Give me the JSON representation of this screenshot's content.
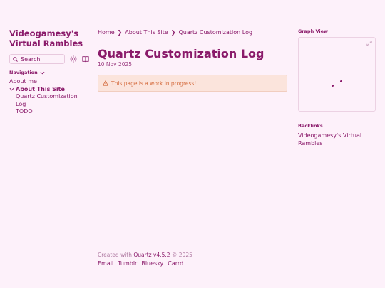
{
  "sidebar": {
    "site_title": "Videogamesy's Virtual Rambles",
    "search_label": "Search",
    "nav_heading": "Navigation",
    "items": [
      {
        "label": "About me"
      },
      {
        "label": "About This Site"
      },
      {
        "label": "Quartz Customization Log"
      },
      {
        "label": "TODO"
      }
    ]
  },
  "breadcrumbs": [
    "Home",
    "About This Site",
    "Quartz Customization Log"
  ],
  "page": {
    "title": "Quartz Customization Log",
    "date": "10 Nov 2025",
    "callout": "This page is a work in progress!"
  },
  "graph": {
    "title": "Graph View"
  },
  "backlinks": {
    "title": "Backlinks",
    "items": [
      "Videogamesy's Virtual Rambles"
    ]
  },
  "footer": {
    "created_prefix": "Created with",
    "created_link": "Quartz v4.5.2",
    "copyright": "© 2025",
    "links": [
      "Email",
      "Tumblr",
      "Bluesky",
      "Carrd"
    ]
  },
  "colors": {
    "background": "#fdf1fa",
    "accent": "#8a1a6a",
    "callout_bg": "#fbe4dc",
    "callout_text": "#d46a3c"
  }
}
